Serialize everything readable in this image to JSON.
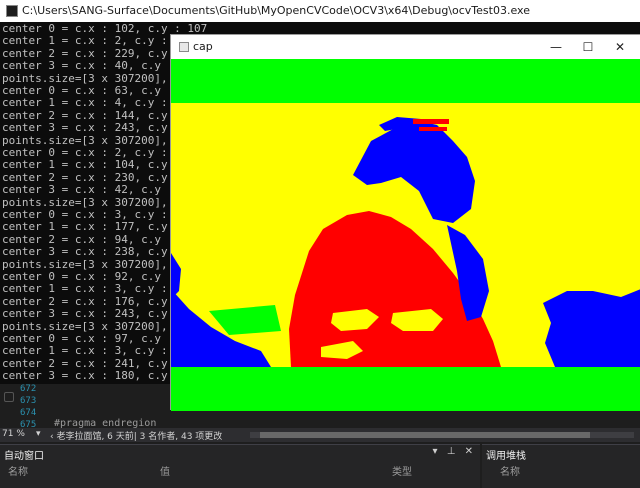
{
  "console_window": {
    "title": "C:\\Users\\SANG-Surface\\Documents\\GitHub\\MyOpenCVCode\\OCV3\\x64\\Debug\\ocvTest03.exe",
    "lines": [
      "center 0 = c.x : 102, c.y : 107",
      "center 1 = c.x : 2, c.y : 2",
      "center 2 = c.x : 229, c.y : 1",
      "center 3 = c.x : 40, c.y : 48",
      "points.size=[3 x 307200], lab",
      "center 0 = c.x : 63, c.y : 70",
      "center 1 = c.x : 4, c.y : 3",
      "center 2 = c.x : 144, c.y : 1",
      "center 3 = c.x : 243, c.y : 2",
      "points.size=[3 x 307200], lab",
      "center 0 = c.x : 2, c.y : 2",
      "center 1 = c.x : 104, c.y : 1",
      "center 2 = c.x : 230, c.y : 2",
      "center 3 = c.x : 42, c.y : 50",
      "points.size=[3 x 307200], lab",
      "center 0 = c.x : 3, c.y : 2",
      "center 1 = c.x : 177, c.y : 1",
      "center 2 = c.x : 94, c.y : 93",
      "center 3 = c.x : 238, c.y : 2",
      "points.size=[3 x 307200], lab",
      "center 0 = c.x : 92, c.y : 94",
      "center 1 = c.x : 3, c.y : 3",
      "center 2 = c.x : 176, c.y : 1",
      "center 3 = c.x : 243, c.y : 2",
      "points.size=[3 x 307200], lab",
      "center 0 = c.x : 97, c.y : 95",
      "center 1 = c.x : 3, c.y : 2",
      "center 2 = c.x : 241, c.y : 2",
      "center 3 = c.x : 180, c.y : 1"
    ]
  },
  "cap_window": {
    "title": "cap",
    "minimize_glyph": "—",
    "maximize_glyph": "☐",
    "close_glyph": "✕"
  },
  "cluster_colors": {
    "green": "#00ff00",
    "yellow": "#ffff00",
    "red": "#ff0000",
    "blue": "#0000ff"
  },
  "editor": {
    "line_numbers": [
      "672",
      "673",
      "674",
      "675"
    ],
    "code_fragment": "#pragma endregion"
  },
  "status_bar": {
    "zoom": "71 %",
    "zoom_arrow": "▾",
    "codelens": "‹ 老李拉面馆, 6 天前| 3 名作者, 43 项更改"
  },
  "autos_panel": {
    "title": "自动窗口",
    "controls": "▾ ⊥ ✕",
    "columns": [
      "名称",
      "值",
      "类型"
    ]
  },
  "callstack_panel": {
    "title": "调用堆栈",
    "columns": [
      "名称"
    ]
  }
}
